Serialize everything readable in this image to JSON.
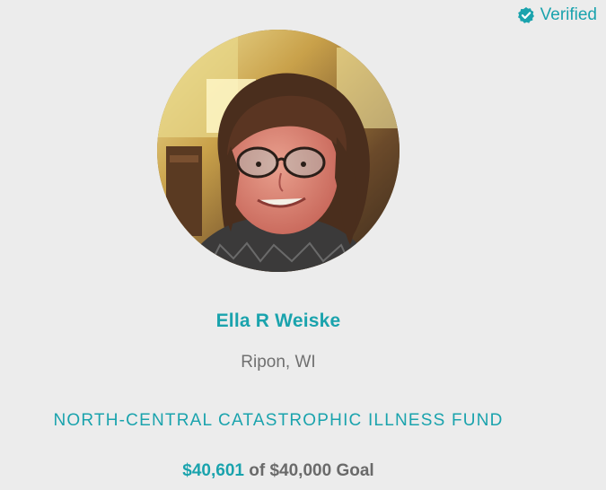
{
  "badge": {
    "label": "Verified",
    "icon": "verified-check-icon",
    "color": "#1aa3ad"
  },
  "profile": {
    "photo_alt": "Ella R Weiske",
    "name": "Ella R Weiske",
    "location": "Ripon, WI"
  },
  "fund": {
    "name": "NORTH-CENTRAL CATASTROPHIC ILLNESS FUND"
  },
  "progress": {
    "raised": "$40,601",
    "of_text": "of",
    "goal": "$40,000",
    "goal_suffix": "Goal"
  },
  "colors": {
    "accent": "#1aa3ad",
    "background": "#ececec",
    "muted_text": "#707070"
  }
}
